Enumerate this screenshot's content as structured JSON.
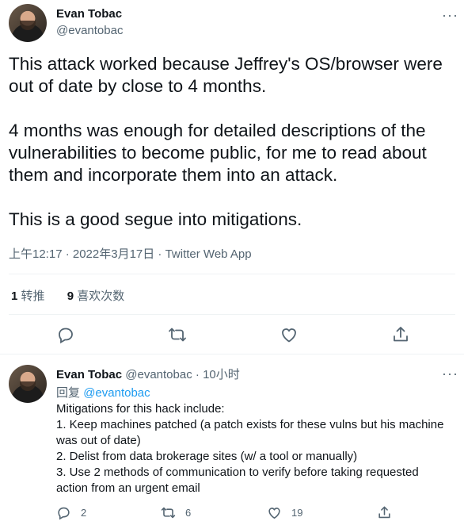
{
  "tweet": {
    "author_name": "Evan Tobac",
    "author_handle": "@evantobac",
    "more_label": "···",
    "paragraphs": [
      "This attack worked because Jeffrey's OS/browser were out of date by close to 4 months.",
      "4 months was enough for detailed descriptions of the vulnerabilities to become public, for me to read about them and incorporate them into an attack.",
      "This is a good segue into mitigations."
    ],
    "meta": "上午12:17 · 2022年3月17日 · Twitter Web App",
    "stats": {
      "retweets_count": "1",
      "retweets_label": "转推",
      "likes_count": "9",
      "likes_label": "喜欢次数"
    },
    "icons": [
      "reply-icon",
      "retweet-icon",
      "like-icon",
      "share-icon"
    ]
  },
  "reply": {
    "author_name": "Evan Tobac",
    "author_handle": "@evantobac",
    "separator": "·",
    "time": "10小时",
    "more_label": "···",
    "replying_label": "回复",
    "replying_to": "@evantobac",
    "lines": [
      "Mitigations for this hack include:",
      "1. Keep machines patched (a patch exists for these vulns but his machine was out of date)",
      "2. Delist from data brokerage sites (w/ a tool or manually)",
      "3. Use 2 methods of communication to verify before taking requested action from an urgent email"
    ],
    "counts": {
      "replies": "2",
      "retweets": "6",
      "likes": "19"
    }
  },
  "colors": {
    "text": "#0f1419",
    "secondary": "#536471",
    "link": "#1d9bf0",
    "divider": "#eff3f4"
  }
}
